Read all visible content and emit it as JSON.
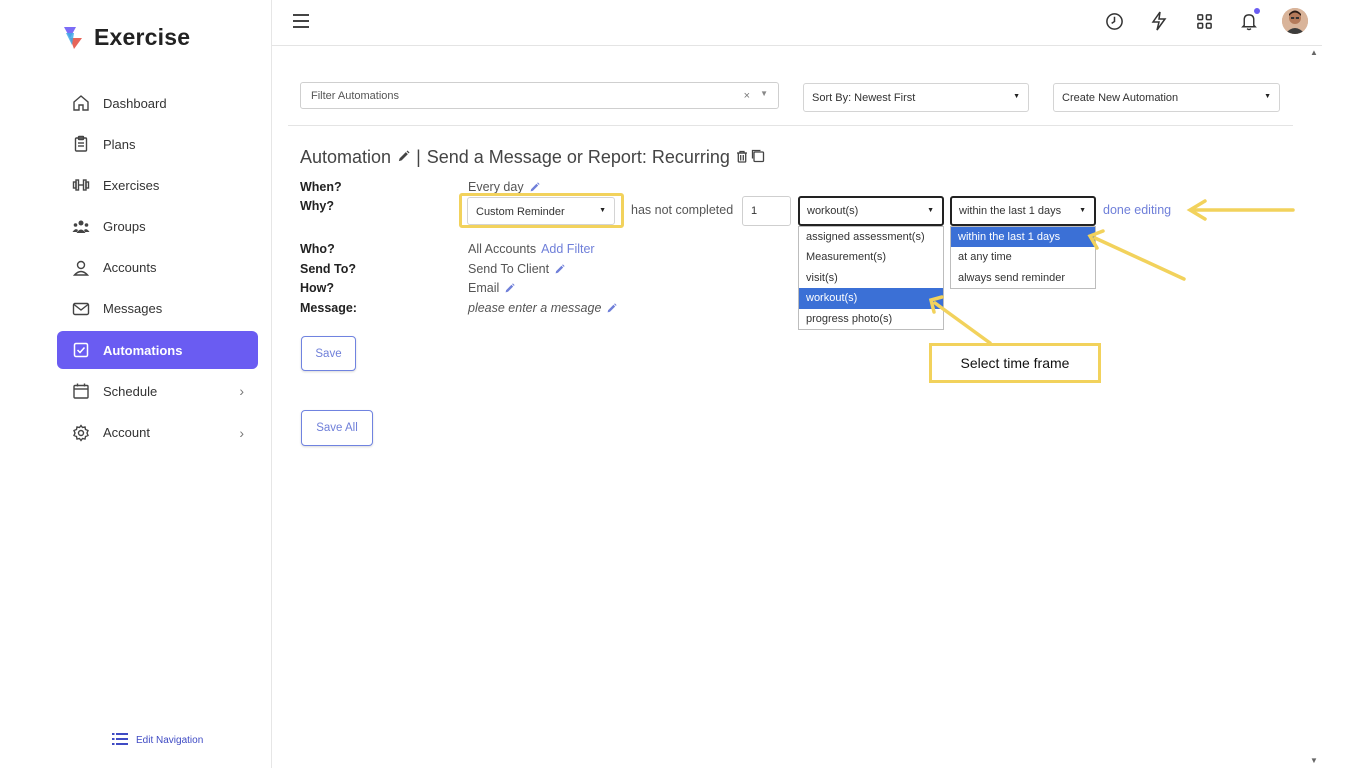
{
  "app": {
    "name": "Exercise"
  },
  "sidebar": {
    "items": [
      {
        "label": "Dashboard",
        "icon": "home-icon"
      },
      {
        "label": "Plans",
        "icon": "clipboard-icon"
      },
      {
        "label": "Exercises",
        "icon": "dumbbell-icon"
      },
      {
        "label": "Groups",
        "icon": "users-icon"
      },
      {
        "label": "Accounts",
        "icon": "user-icon"
      },
      {
        "label": "Messages",
        "icon": "mail-icon"
      },
      {
        "label": "Automations",
        "icon": "checkbox-icon",
        "active": true
      },
      {
        "label": "Schedule",
        "icon": "calendar-icon",
        "has_submenu": true
      },
      {
        "label": "Account",
        "icon": "gear-icon",
        "has_submenu": true
      }
    ],
    "edit_navigation": "Edit Navigation"
  },
  "toolbar": {
    "filter_placeholder": "Filter Automations",
    "filter_clear": "×",
    "sort_label": "Sort By: Newest First",
    "create_label": "Create New Automation"
  },
  "automation": {
    "title_prefix": "Automation",
    "separator": "|",
    "title_rest": "Send a Message or Report: Recurring",
    "when_label": "When?",
    "when_value": "Every day",
    "why_label": "Why?",
    "why_select": "Custom Reminder",
    "has_not_completed": "has not completed",
    "count_value": "1",
    "item_select": "workout(s)",
    "time_select": "within the last 1 days",
    "done_editing": "done editing",
    "who_label": "Who?",
    "who_value": "All Accounts",
    "add_filter": "Add Filter",
    "send_to_label": "Send To?",
    "send_to_value": "Send To Client",
    "how_label": "How?",
    "how_value": "Email",
    "message_label": "Message:",
    "message_value": "please enter a message",
    "save": "Save",
    "save_all": "Save All"
  },
  "item_dropdown": {
    "options": [
      "assigned assessment(s)",
      "Measurement(s)",
      "visit(s)",
      "workout(s)",
      "progress photo(s)"
    ],
    "selected": "workout(s)"
  },
  "time_dropdown": {
    "options": [
      "within the last 1 days",
      "at any time",
      "always send reminder"
    ],
    "selected": "within the last 1 days"
  },
  "callout": {
    "text": "Select time frame"
  },
  "colors": {
    "accent": "#6a5cf2",
    "highlight": "#f2d25c",
    "link": "#6f7fd9",
    "selected_option": "#3b70d6"
  }
}
